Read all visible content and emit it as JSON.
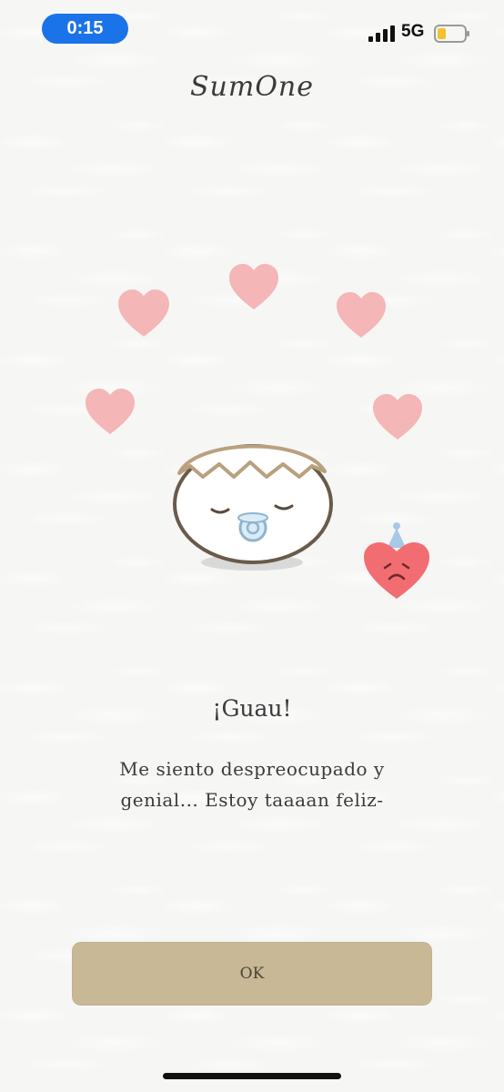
{
  "status_bar": {
    "time": "0:15",
    "network": "5G",
    "signal_icon": "signal-bars-icon",
    "battery_icon": "battery-low-icon",
    "battery_color": "#f2c230",
    "time_pill_color": "#1a73e8"
  },
  "app": {
    "logo": "SumOne"
  },
  "illustration": {
    "heart_color": "#f4b6b6",
    "egg_icon": "hatching-egg-icon",
    "sad_heart_icon": "sad-heart-with-party-hat-icon"
  },
  "dialog": {
    "title": "¡Guau!",
    "message": "Me siento despreocupado y genial... Estoy taaaan feliz-",
    "ok_label": "OK",
    "button_color": "#c8b896"
  }
}
